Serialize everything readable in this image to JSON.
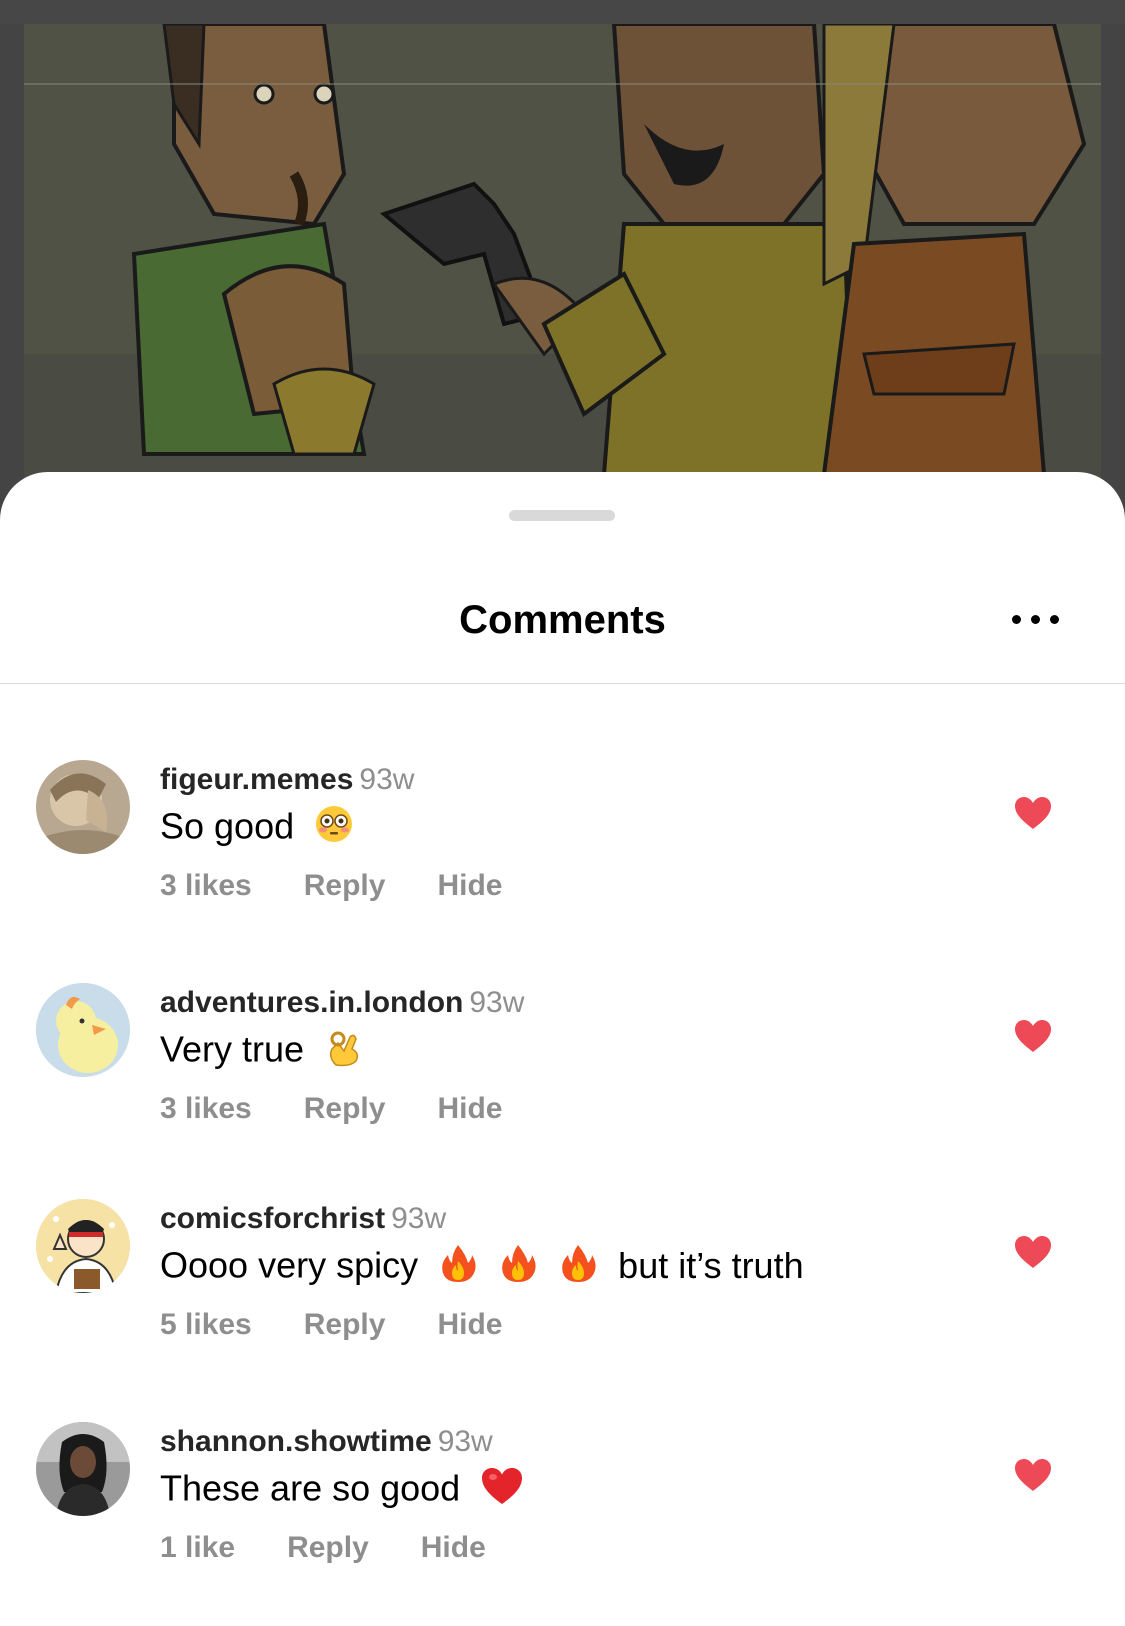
{
  "sheet": {
    "title": "Comments",
    "more_icon": "more-horizontal-icon"
  },
  "colors": {
    "heart": "#ED4956",
    "username": "#262626",
    "meta": "#8E8E8E"
  },
  "comments": [
    {
      "username": "figeur.memes",
      "time": "93w",
      "text": "So good",
      "emoji": [
        "flushed-face"
      ],
      "likes": "3 likes",
      "reply": "Reply",
      "hide": "Hide",
      "liked": true
    },
    {
      "username": "adventures.in.london",
      "time": "93w",
      "text": "Very true",
      "emoji": [
        "ok-hand"
      ],
      "likes": "3 likes",
      "reply": "Reply",
      "hide": "Hide",
      "liked": true
    },
    {
      "username": "comicsforchrist",
      "time": "93w",
      "text": "Oooo very spicy",
      "emoji": [
        "fire",
        "fire",
        "fire"
      ],
      "text_after": "but it’s truth",
      "likes": "5 likes",
      "reply": "Reply",
      "hide": "Hide",
      "liked": true
    },
    {
      "username": "shannon.showtime",
      "time": "93w",
      "text": "These are so good",
      "emoji": [
        "red-heart"
      ],
      "likes": "1 like",
      "reply": "Reply",
      "hide": "Hide",
      "liked": true
    }
  ]
}
